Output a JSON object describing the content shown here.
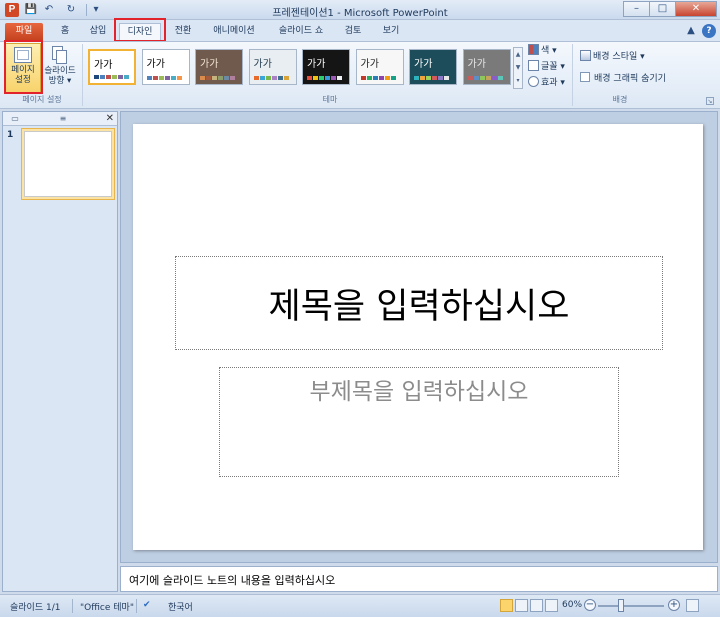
{
  "window": {
    "title": "프레젠테이션1 - Microsoft PowerPoint",
    "controls": {
      "minimize": "–",
      "maximize": "□",
      "close": "✕"
    }
  },
  "qat": {
    "app_icon": "P",
    "save": "💾",
    "undo": "↶",
    "redo": "↻",
    "customize": "▾"
  },
  "tabs": [
    {
      "label": "파일",
      "kind": "file"
    },
    {
      "label": "홈"
    },
    {
      "label": "삽입"
    },
    {
      "label": "디자인",
      "active": true,
      "highlighted": true
    },
    {
      "label": "전환"
    },
    {
      "label": "애니메이션"
    },
    {
      "label": "슬라이드 쇼"
    },
    {
      "label": "검토"
    },
    {
      "label": "보기"
    }
  ],
  "tab_controls": {
    "minimize_ribbon": "▲",
    "help": "?"
  },
  "ribbon": {
    "page_setup_group": {
      "label": "페이지 설정",
      "page_setup_button": {
        "line1": "페이지",
        "line2": "설정"
      },
      "orientation_button": {
        "line1": "슬라이드",
        "line2": "방향 ▾"
      }
    },
    "themes_group": {
      "label": "테마",
      "themes": [
        {
          "text": "가가",
          "bg": "#ffffff",
          "fg": "#000000",
          "selected": true,
          "swatches": [
            "#1f497d",
            "#4f81bd",
            "#c0504d",
            "#9bbb59",
            "#8064a2",
            "#4bacc6"
          ]
        },
        {
          "text": "가가",
          "bg": "#ffffff",
          "fg": "#000000",
          "swatches": [
            "#4f81bd",
            "#c0504d",
            "#9bbb59",
            "#8064a2",
            "#4bacc6",
            "#f79646"
          ]
        },
        {
          "text": "가가",
          "bg": "#6f5a4d",
          "fg": "#f4e3d1",
          "swatches": [
            "#d98c4c",
            "#a45a3c",
            "#c6b37e",
            "#8d9c6b",
            "#6c8aa4",
            "#b07f9e"
          ]
        },
        {
          "text": "가가",
          "bg": "#e9eef2",
          "fg": "#1f3a4d",
          "swatches": [
            "#e86b2a",
            "#3aa6d8",
            "#7bb64a",
            "#a97fc6",
            "#3d6f8f",
            "#d9a43a"
          ]
        },
        {
          "text": "가가",
          "bg": "#151515",
          "fg": "#ffffff",
          "swatches": [
            "#e84c3d",
            "#f1c40f",
            "#2ecc71",
            "#3498db",
            "#9b59b6",
            "#ecf0f1"
          ]
        },
        {
          "text": "가가",
          "bg": "#f7f7f7",
          "fg": "#222222",
          "swatches": [
            "#c0392b",
            "#27ae60",
            "#2980b9",
            "#8e44ad",
            "#f39c12",
            "#16a085"
          ]
        },
        {
          "text": "가가",
          "bg": "#1d4d5a",
          "fg": "#ffffff",
          "swatches": [
            "#2bb3c0",
            "#f1a340",
            "#9ed35a",
            "#d25a5a",
            "#8a7ac6",
            "#e6e6e6"
          ]
        },
        {
          "text": "가가",
          "bg": "#7a7a7a",
          "fg": "#e8e8e8",
          "swatches": [
            "#c65c5c",
            "#5c8fc6",
            "#8fc65c",
            "#c6a35c",
            "#8a5cc6",
            "#5cc6b8"
          ]
        }
      ],
      "scroll": {
        "up": "▲",
        "down": "▼",
        "more": "▾"
      },
      "colors_label": "색 ▾",
      "fonts_label": "글꼴 ▾",
      "effects_label": "효과 ▾"
    },
    "background_group": {
      "label": "배경",
      "styles_label": "배경 스타일 ▾",
      "hide_graphics_label": "배경 그래픽 숨기기",
      "launcher": "↘"
    }
  },
  "slide_panel": {
    "tab_slides_icon": "▭",
    "tab_outline_icon": "≡",
    "close": "✕",
    "slide_number": "1"
  },
  "slide": {
    "title_placeholder": "제목을 입력하십시오",
    "subtitle_placeholder": "부제목을 입력하십시오"
  },
  "notes_placeholder": "여기에 슬라이드 노트의 내용을 입력하십시오",
  "status": {
    "slide_info": "슬라이드 1/1",
    "theme_name": "\"Office 테마\"",
    "language": "한국어",
    "zoom": "60%",
    "zoom_minus": "−",
    "zoom_plus": "+",
    "spell_check_icon": "✔"
  }
}
